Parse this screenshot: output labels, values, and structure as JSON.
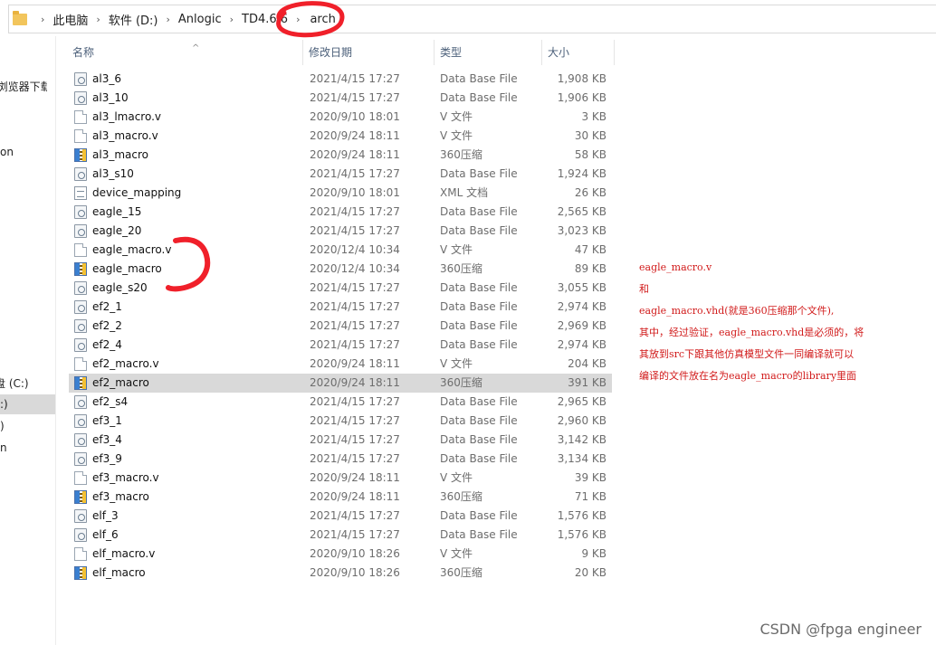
{
  "address_bar": {
    "crumbs": [
      "此电脑",
      "软件 (D:)",
      "Anlogic",
      "TD4.6.6",
      "arch"
    ]
  },
  "nav_pane": {
    "items": [
      "c浏览器下载",
      "on",
      "盘 (C:)",
      ":)",
      ")",
      "n"
    ]
  },
  "columns": {
    "name": "名称",
    "date": "修改日期",
    "type": "类型",
    "size": "大小"
  },
  "files": [
    {
      "name": "al3_6",
      "date": "2021/4/15 17:27",
      "type": "Data Base File",
      "size": "1,908 KB",
      "icon": "database-file-icon"
    },
    {
      "name": "al3_10",
      "date": "2021/4/15 17:27",
      "type": "Data Base File",
      "size": "1,906 KB",
      "icon": "database-file-icon"
    },
    {
      "name": "al3_lmacro.v",
      "date": "2020/9/10 18:01",
      "type": "V 文件",
      "size": "3 KB",
      "icon": "v-file-icon"
    },
    {
      "name": "al3_macro.v",
      "date": "2020/9/24 18:11",
      "type": "V 文件",
      "size": "30 KB",
      "icon": "v-file-icon"
    },
    {
      "name": "al3_macro",
      "date": "2020/9/24 18:11",
      "type": "360压缩",
      "size": "58 KB",
      "icon": "zip-archive-icon"
    },
    {
      "name": "al3_s10",
      "date": "2021/4/15 17:27",
      "type": "Data Base File",
      "size": "1,924 KB",
      "icon": "database-file-icon"
    },
    {
      "name": "device_mapping",
      "date": "2020/9/10 18:01",
      "type": "XML 文档",
      "size": "26 KB",
      "icon": "xml-file-icon"
    },
    {
      "name": "eagle_15",
      "date": "2021/4/15 17:27",
      "type": "Data Base File",
      "size": "2,565 KB",
      "icon": "database-file-icon"
    },
    {
      "name": "eagle_20",
      "date": "2021/4/15 17:27",
      "type": "Data Base File",
      "size": "3,023 KB",
      "icon": "database-file-icon"
    },
    {
      "name": "eagle_macro.v",
      "date": "2020/12/4 10:34",
      "type": "V 文件",
      "size": "47 KB",
      "icon": "v-file-icon"
    },
    {
      "name": "eagle_macro",
      "date": "2020/12/4 10:34",
      "type": "360压缩",
      "size": "89 KB",
      "icon": "zip-archive-icon"
    },
    {
      "name": "eagle_s20",
      "date": "2021/4/15 17:27",
      "type": "Data Base File",
      "size": "3,055 KB",
      "icon": "database-file-icon"
    },
    {
      "name": "ef2_1",
      "date": "2021/4/15 17:27",
      "type": "Data Base File",
      "size": "2,974 KB",
      "icon": "database-file-icon"
    },
    {
      "name": "ef2_2",
      "date": "2021/4/15 17:27",
      "type": "Data Base File",
      "size": "2,969 KB",
      "icon": "database-file-icon"
    },
    {
      "name": "ef2_4",
      "date": "2021/4/15 17:27",
      "type": "Data Base File",
      "size": "2,974 KB",
      "icon": "database-file-icon"
    },
    {
      "name": "ef2_macro.v",
      "date": "2020/9/24 18:11",
      "type": "V 文件",
      "size": "204 KB",
      "icon": "v-file-icon"
    },
    {
      "name": "ef2_macro",
      "date": "2020/9/24 18:11",
      "type": "360压缩",
      "size": "391 KB",
      "icon": "zip-archive-icon",
      "selected": true
    },
    {
      "name": "ef2_s4",
      "date": "2021/4/15 17:27",
      "type": "Data Base File",
      "size": "2,965 KB",
      "icon": "database-file-icon"
    },
    {
      "name": "ef3_1",
      "date": "2021/4/15 17:27",
      "type": "Data Base File",
      "size": "2,960 KB",
      "icon": "database-file-icon"
    },
    {
      "name": "ef3_4",
      "date": "2021/4/15 17:27",
      "type": "Data Base File",
      "size": "3,142 KB",
      "icon": "database-file-icon"
    },
    {
      "name": "ef3_9",
      "date": "2021/4/15 17:27",
      "type": "Data Base File",
      "size": "3,134 KB",
      "icon": "database-file-icon"
    },
    {
      "name": "ef3_macro.v",
      "date": "2020/9/24 18:11",
      "type": "V 文件",
      "size": "39 KB",
      "icon": "v-file-icon"
    },
    {
      "name": "ef3_macro",
      "date": "2020/9/24 18:11",
      "type": "360压缩",
      "size": "71 KB",
      "icon": "zip-archive-icon"
    },
    {
      "name": "elf_3",
      "date": "2021/4/15 17:27",
      "type": "Data Base File",
      "size": "1,576 KB",
      "icon": "database-file-icon"
    },
    {
      "name": "elf_6",
      "date": "2021/4/15 17:27",
      "type": "Data Base File",
      "size": "1,576 KB",
      "icon": "database-file-icon"
    },
    {
      "name": "elf_macro.v",
      "date": "2020/9/10 18:26",
      "type": "V 文件",
      "size": "9 KB",
      "icon": "v-file-icon"
    },
    {
      "name": "elf_macro",
      "date": "2020/9/10 18:26",
      "type": "360压缩",
      "size": "20 KB",
      "icon": "zip-archive-icon"
    }
  ],
  "annotation": {
    "lines": [
      "eagle_macro.v",
      "和",
      "eagle_macro.vhd(就是360压缩那个文件),",
      "其中，经过验证，eagle_macro.vhd是必须的，将",
      "其放到src下跟其他仿真模型文件一同编译就可以",
      "编译的文件放在名为eagle_macro的library里面"
    ],
    "color": "#d11a1a"
  },
  "watermark": "CSDN @fpga engineer"
}
